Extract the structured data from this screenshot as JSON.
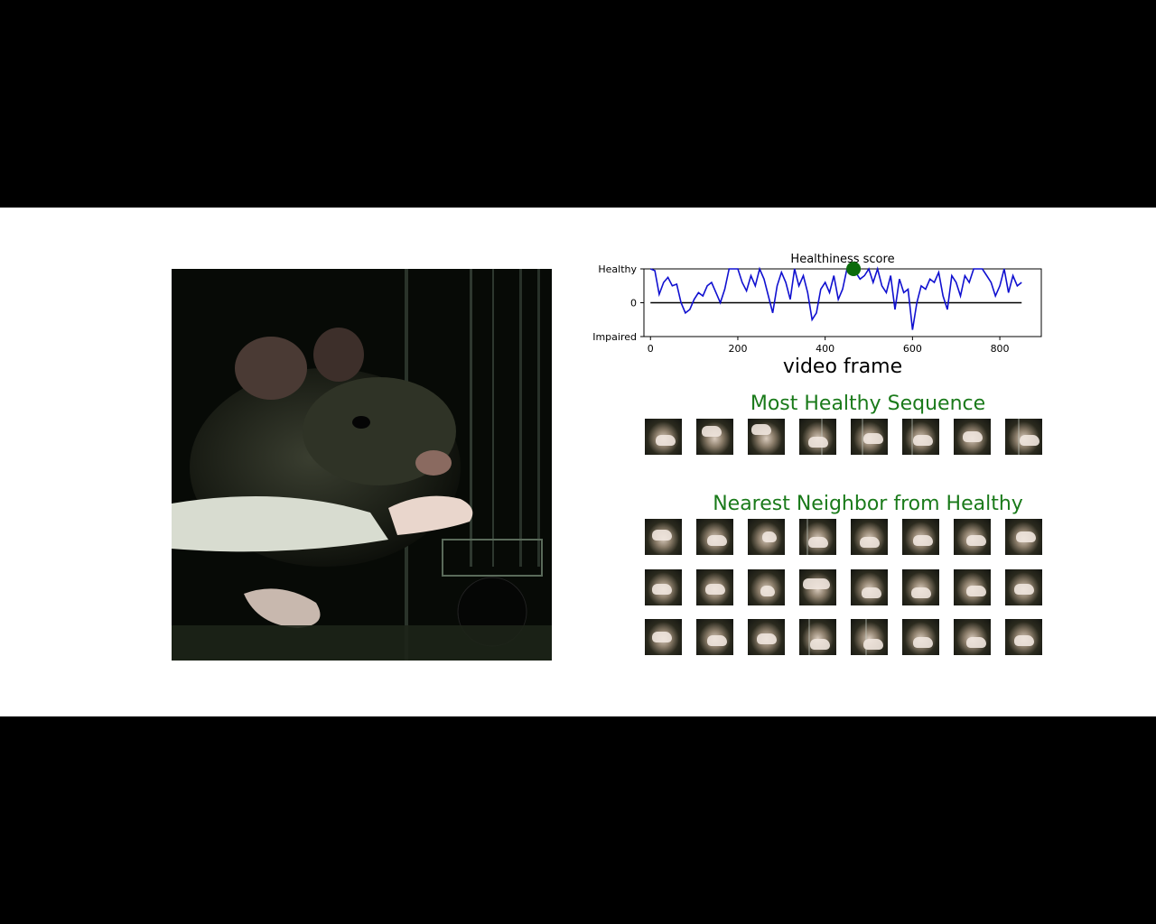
{
  "plot": {
    "title": "Healthiness score",
    "xlabel": "video frame",
    "yticks": [
      "Healthy",
      "0",
      "Impaired"
    ],
    "xticks": [
      "0",
      "200",
      "400",
      "600",
      "800"
    ]
  },
  "chart_data": {
    "type": "line",
    "title": "Healthiness score",
    "xlabel": "video frame",
    "ylabel": "",
    "xlim": [
      0,
      860
    ],
    "ylim": [
      -1,
      1
    ],
    "ytick_labels": {
      "1": "Healthy",
      "0": "0",
      "-1": "Impaired"
    },
    "x": [
      0,
      10,
      20,
      30,
      40,
      50,
      60,
      70,
      80,
      90,
      100,
      110,
      120,
      130,
      140,
      150,
      160,
      170,
      180,
      190,
      200,
      210,
      220,
      230,
      240,
      250,
      260,
      270,
      280,
      290,
      300,
      310,
      320,
      330,
      340,
      350,
      360,
      370,
      380,
      390,
      400,
      410,
      420,
      430,
      440,
      450,
      460,
      470,
      480,
      490,
      500,
      510,
      520,
      530,
      540,
      550,
      560,
      570,
      580,
      590,
      600,
      610,
      620,
      630,
      640,
      650,
      660,
      670,
      680,
      690,
      700,
      710,
      720,
      730,
      740,
      750,
      760,
      770,
      780,
      790,
      800,
      810,
      820,
      830,
      840,
      850
    ],
    "y": [
      1.0,
      0.95,
      0.25,
      0.6,
      0.75,
      0.5,
      0.55,
      0.0,
      -0.3,
      -0.2,
      0.1,
      0.3,
      0.2,
      0.5,
      0.6,
      0.3,
      0.0,
      0.4,
      1.0,
      1.0,
      1.0,
      0.6,
      0.35,
      0.8,
      0.5,
      1.0,
      0.7,
      0.2,
      -0.3,
      0.5,
      0.9,
      0.6,
      0.1,
      1.0,
      0.5,
      0.8,
      0.3,
      -0.5,
      -0.3,
      0.4,
      0.6,
      0.3,
      0.8,
      0.1,
      0.4,
      1.0,
      1.0,
      0.9,
      0.7,
      0.8,
      1.0,
      0.6,
      1.0,
      0.5,
      0.3,
      0.8,
      -0.2,
      0.7,
      0.3,
      0.4,
      -0.8,
      0.0,
      0.5,
      0.4,
      0.7,
      0.6,
      0.9,
      0.2,
      -0.2,
      0.8,
      0.6,
      0.2,
      0.8,
      0.6,
      1.0,
      1.0,
      1.0,
      0.8,
      0.6,
      0.2,
      0.5,
      1.0,
      0.3,
      0.8,
      0.5,
      0.6
    ],
    "series": [
      {
        "values": []
      }
    ],
    "marker": {
      "x": 465,
      "y": 1.0,
      "color": "#0b6b0b"
    },
    "line_color": "#1010d0",
    "zero_line": true,
    "grid": false
  },
  "sections": {
    "most_healthy": "Most Healthy Sequence",
    "nearest_neighbor": "Nearest Neighbor from Healthy"
  },
  "colors": {
    "title_green": "#1a7a1a"
  }
}
